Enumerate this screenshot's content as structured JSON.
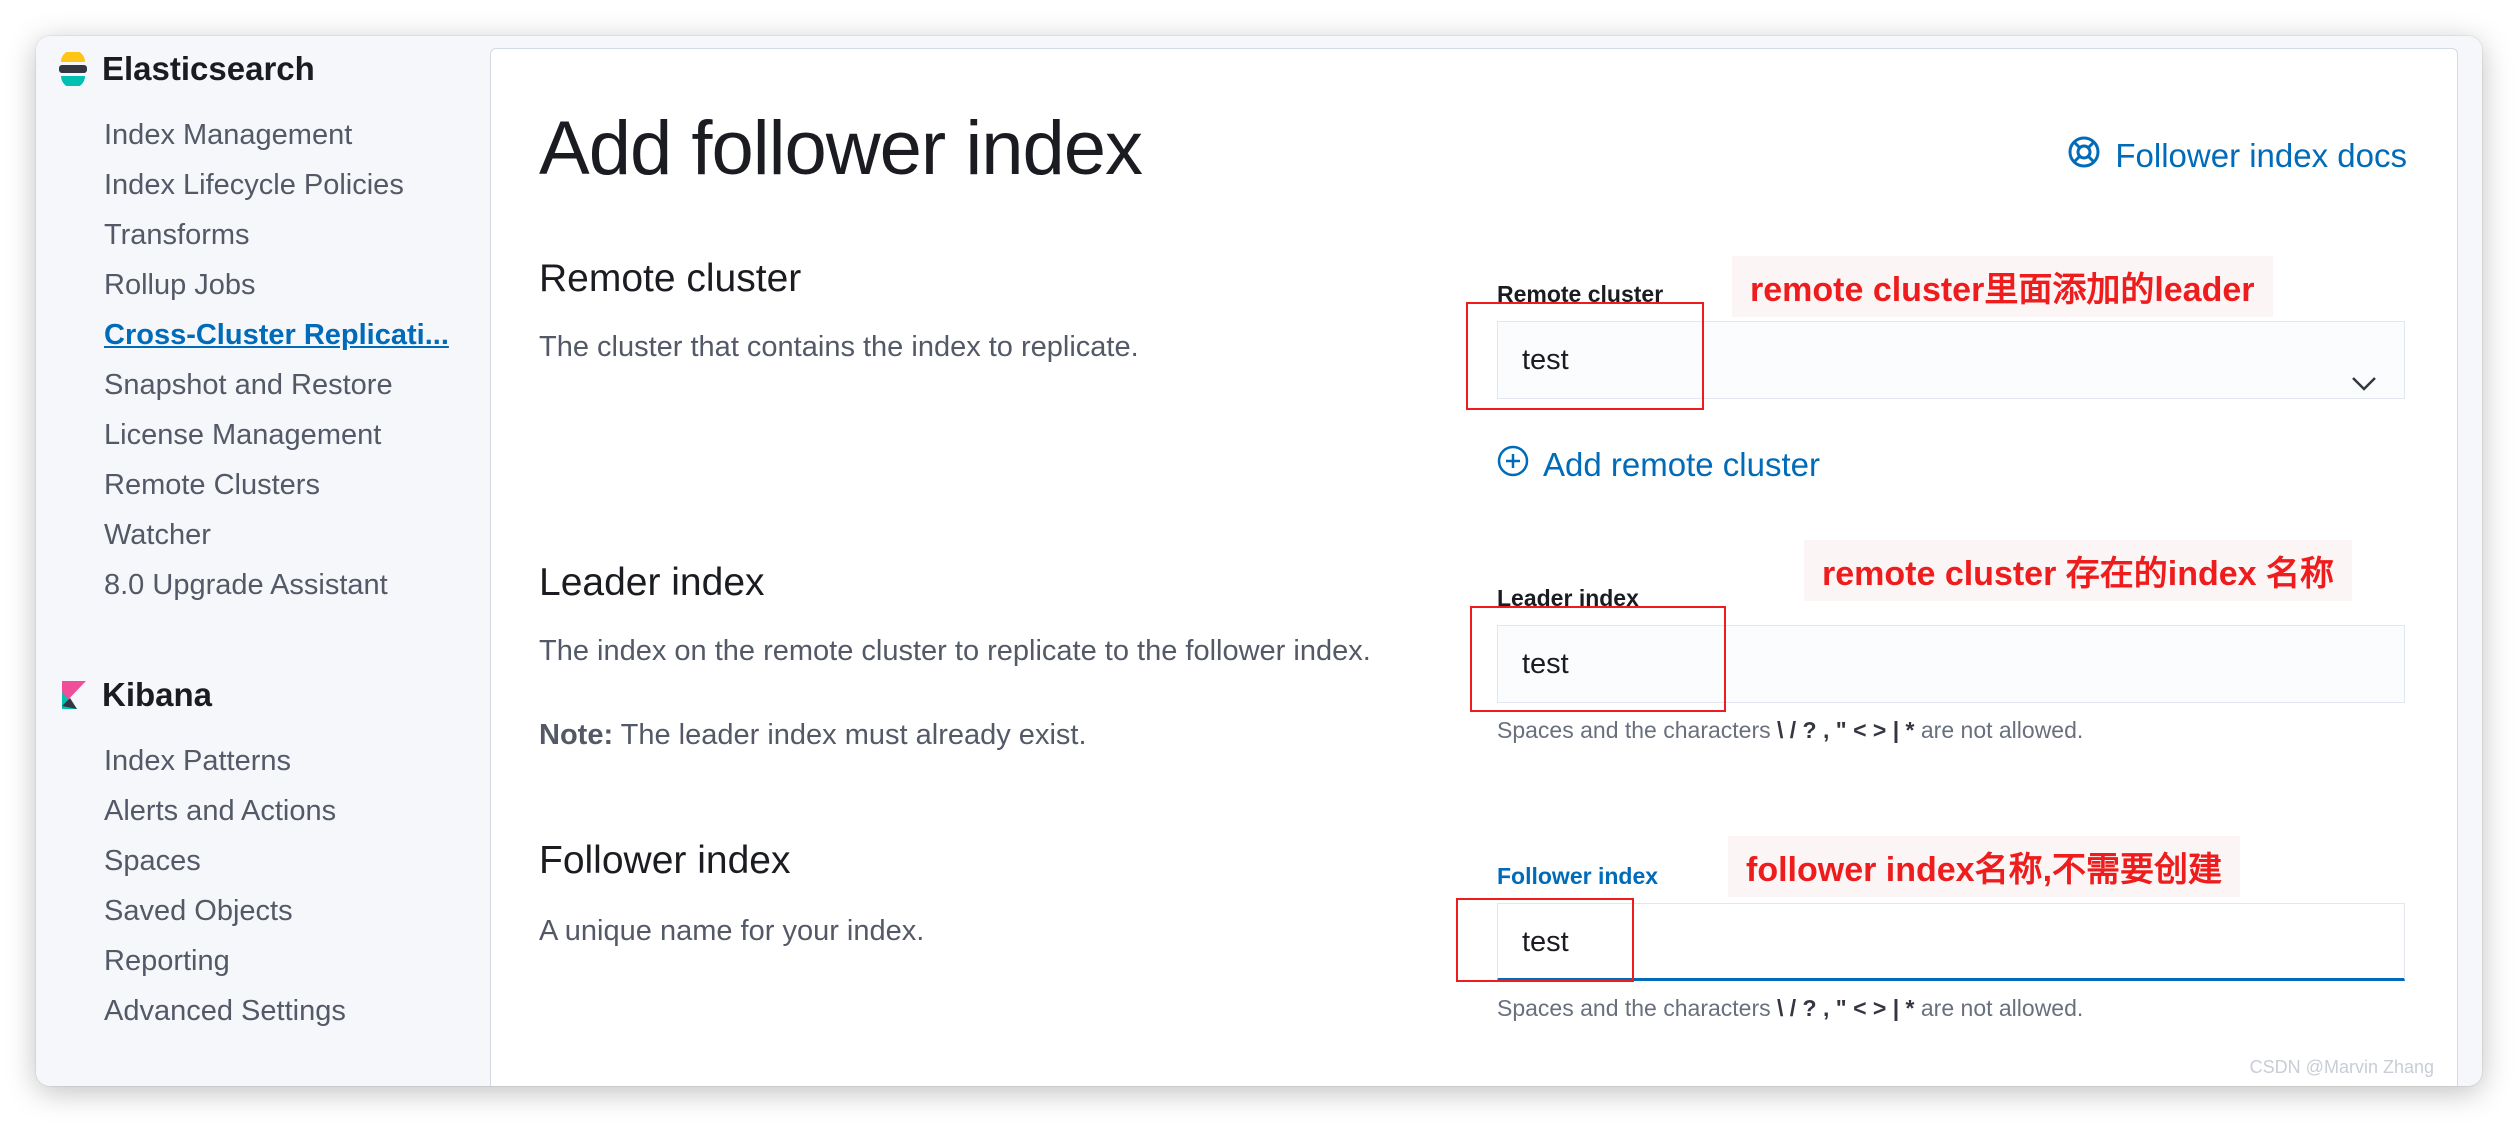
{
  "sidebar": {
    "elasticsearch": {
      "title": "Elasticsearch",
      "items": [
        {
          "label": "Index Management"
        },
        {
          "label": "Index Lifecycle Policies"
        },
        {
          "label": "Transforms"
        },
        {
          "label": "Rollup Jobs"
        },
        {
          "label": "Cross-Cluster Replicati..."
        },
        {
          "label": "Snapshot and Restore"
        },
        {
          "label": "License Management"
        },
        {
          "label": "Remote Clusters"
        },
        {
          "label": "Watcher"
        },
        {
          "label": "8.0 Upgrade Assistant"
        }
      ]
    },
    "kibana": {
      "title": "Kibana",
      "items": [
        {
          "label": "Index Patterns"
        },
        {
          "label": "Alerts and Actions"
        },
        {
          "label": "Spaces"
        },
        {
          "label": "Saved Objects"
        },
        {
          "label": "Reporting"
        },
        {
          "label": "Advanced Settings"
        }
      ]
    },
    "active_item": "Cross-Cluster Replicati..."
  },
  "page": {
    "title": "Add follower index",
    "docs_link": "Follower index docs"
  },
  "sections": {
    "remote_cluster": {
      "title": "Remote cluster",
      "description": "The cluster that contains the index to replicate.",
      "field_label": "Remote cluster",
      "value": "test",
      "add_link": "Add remote cluster"
    },
    "leader_index": {
      "title": "Leader index",
      "description": "The index on the remote cluster to replicate to the follower index.",
      "note_label": "Note:",
      "note_text": "The leader index must already exist.",
      "field_label": "Leader index",
      "value": "test",
      "help_prefix": "Spaces and the characters",
      "help_chars": "\\ / ? , \" < > | *",
      "help_suffix": "are not allowed."
    },
    "follower_index": {
      "title": "Follower index",
      "description": "A unique name for your index.",
      "field_label": "Follower index",
      "value": "test",
      "help_prefix": "Spaces and the characters",
      "help_chars": "\\ / ? , \" < > | *",
      "help_suffix": "are not allowed."
    }
  },
  "annotations": {
    "remote_cluster": "remote cluster里面添加的leader",
    "leader_index": "remote cluster 存在的index 名称",
    "follower_index": "follower index名称,不需要创建"
  },
  "watermark": "CSDN @Marvin Zhang",
  "colors": {
    "link": "#006bb8",
    "annotation": "#ee1c1c",
    "sidebar_bg": "#f5f7fa"
  },
  "icons": {
    "elasticsearch": "elasticsearch-logo-icon",
    "kibana": "kibana-logo-icon",
    "docs": "lifebuoy-icon",
    "add": "plus-in-circle-icon",
    "dropdown": "chevron-down-icon"
  }
}
